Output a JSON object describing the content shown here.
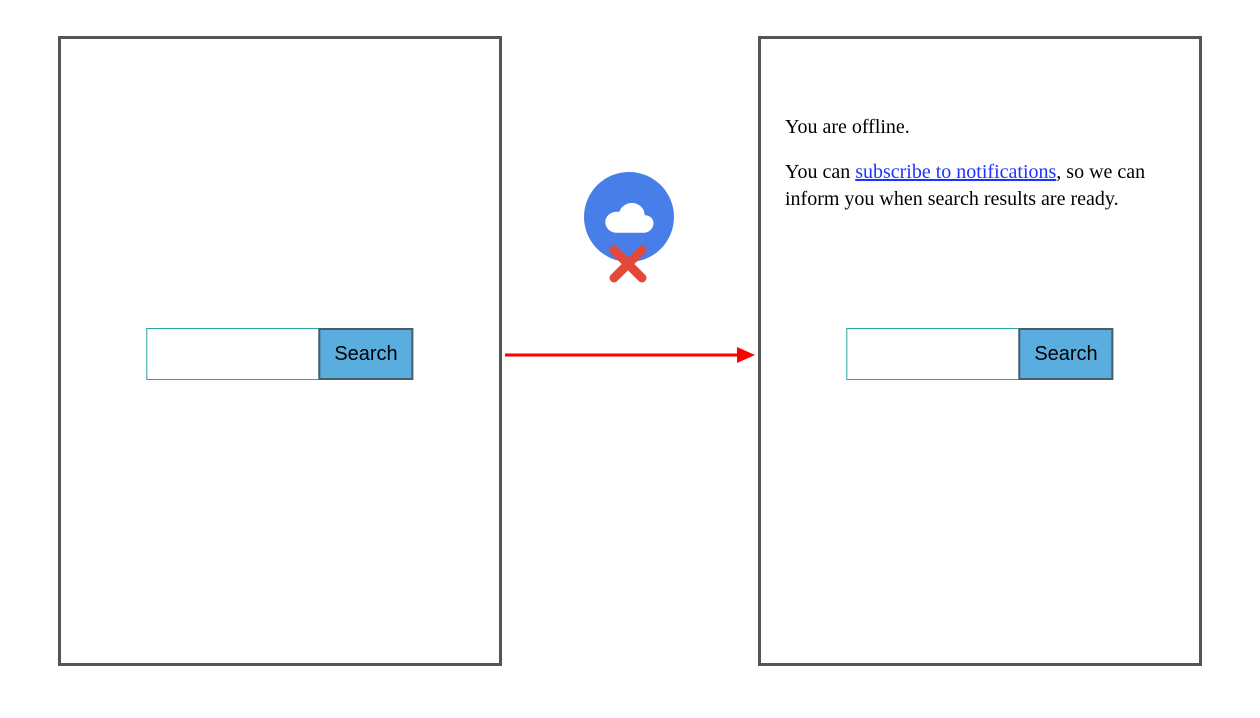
{
  "left": {
    "search": {
      "value": "",
      "placeholder": "",
      "button": "Search"
    }
  },
  "right": {
    "message": {
      "line1": "You are offline.",
      "line2_pre": "You can ",
      "line2_link": "subscribe to notifications",
      "line2_post": ", so we can inform you when search results are ready."
    },
    "search": {
      "value": "",
      "placeholder": "",
      "button": "Search"
    }
  },
  "icons": {
    "cloud": "cloud-icon",
    "x": "close-x-icon",
    "arrow": "right-arrow"
  }
}
